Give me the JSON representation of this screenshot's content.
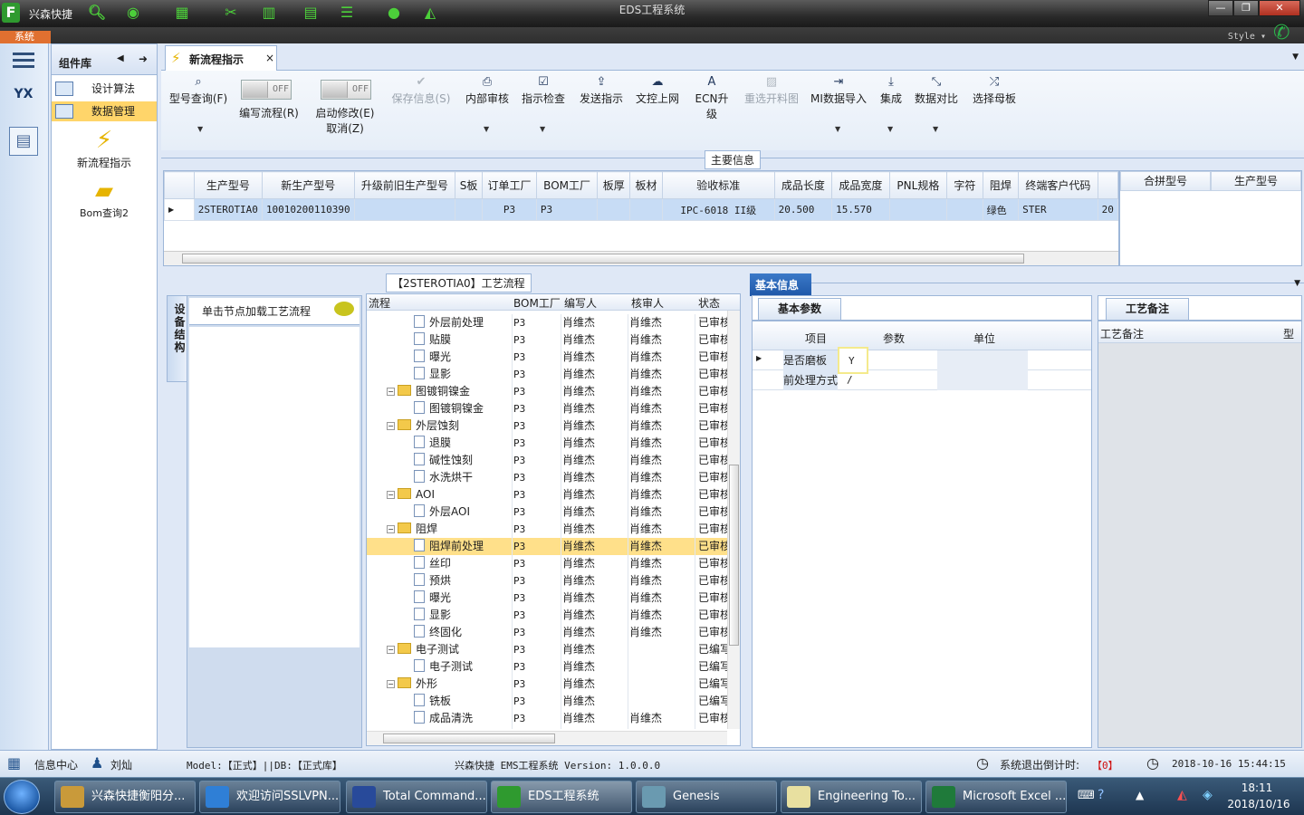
{
  "titlebar": {
    "app_name": "兴森快捷",
    "window_title": "EDS工程系统",
    "min": "—",
    "max": "❐",
    "close": "✕"
  },
  "menubar": {
    "system": "系统",
    "style": "Style"
  },
  "components": {
    "title": "组件库",
    "items": [
      {
        "label": "设计算法",
        "selected": false
      },
      {
        "label": "数据管理",
        "selected": true
      }
    ],
    "big_items": [
      "新流程指示",
      "Bom查询2"
    ]
  },
  "tab": {
    "label": "新流程指示",
    "close": "×"
  },
  "toolbar": {
    "type_query": "型号查询(F)",
    "edit_flow": "编写流程(R)",
    "enable_modify": "启动修改(E)",
    "cancel": "取消(Z)",
    "toggle_off": "OFF",
    "save_info": "保存信息(S)",
    "internal_review": "内部审核",
    "check_instruction": "指示检查",
    "send_instruction": "发送指示",
    "upload": "文控上网",
    "ecn_upgrade": "ECN升级",
    "reselect_drawing": "重选开料图",
    "mi_import": "MI数据导入",
    "integrate": "集成",
    "data_compare": "数据对比",
    "select_master": "选择母板"
  },
  "main_info": {
    "title": "主要信息",
    "columns": [
      "生产型号",
      "新生产型号",
      "升级前旧生产型号",
      "S板",
      "订单工厂",
      "BOM工厂",
      "板厚",
      "板材",
      "验收标准",
      "成品长度",
      "成品宽度",
      "PNL规格",
      "字符",
      "阻焊",
      "终端客户代码"
    ],
    "row": [
      "2STEROTIA0",
      "10010200110390",
      "",
      "",
      "P3",
      "P3",
      "",
      "",
      "IPC-6018 II级",
      "20.500",
      "15.570",
      "",
      "",
      "绿色",
      "STER"
    ],
    "row_tail": "20",
    "side_columns": [
      "合拼型号",
      "生产型号"
    ]
  },
  "flow": {
    "title": "【2STEROTIA0】工艺流程",
    "side_tab": "设备结构",
    "hint": "单击节点加载工艺流程",
    "columns": [
      "流程",
      "BOM工厂",
      "编写人",
      "核审人",
      "状态"
    ],
    "rows": [
      {
        "level": 2,
        "type": "doc",
        "name": "外层前处理",
        "factory": "P3",
        "writer": "肖维杰",
        "reviewer": "肖维杰",
        "status": "已审核"
      },
      {
        "level": 2,
        "type": "doc",
        "name": "贴膜",
        "factory": "P3",
        "writer": "肖维杰",
        "reviewer": "肖维杰",
        "status": "已审核"
      },
      {
        "level": 2,
        "type": "doc",
        "name": "曝光",
        "factory": "P3",
        "writer": "肖维杰",
        "reviewer": "肖维杰",
        "status": "已审核"
      },
      {
        "level": 2,
        "type": "doc",
        "name": "显影",
        "factory": "P3",
        "writer": "肖维杰",
        "reviewer": "肖维杰",
        "status": "已审核"
      },
      {
        "level": 1,
        "type": "folder",
        "name": "图镀铜镍金",
        "factory": "P3",
        "writer": "肖维杰",
        "reviewer": "肖维杰",
        "status": "已审核"
      },
      {
        "level": 2,
        "type": "doc",
        "name": "图镀铜镍金",
        "factory": "P3",
        "writer": "肖维杰",
        "reviewer": "肖维杰",
        "status": "已审核"
      },
      {
        "level": 1,
        "type": "folder",
        "name": "外层蚀刻",
        "factory": "P3",
        "writer": "肖维杰",
        "reviewer": "肖维杰",
        "status": "已审核"
      },
      {
        "level": 2,
        "type": "doc",
        "name": "退膜",
        "factory": "P3",
        "writer": "肖维杰",
        "reviewer": "肖维杰",
        "status": "已审核"
      },
      {
        "level": 2,
        "type": "doc",
        "name": "碱性蚀刻",
        "factory": "P3",
        "writer": "肖维杰",
        "reviewer": "肖维杰",
        "status": "已审核"
      },
      {
        "level": 2,
        "type": "doc",
        "name": "水洗烘干",
        "factory": "P3",
        "writer": "肖维杰",
        "reviewer": "肖维杰",
        "status": "已审核"
      },
      {
        "level": 1,
        "type": "folder",
        "name": "AOI",
        "factory": "P3",
        "writer": "肖维杰",
        "reviewer": "肖维杰",
        "status": "已审核"
      },
      {
        "level": 2,
        "type": "doc",
        "name": "外层AOI",
        "factory": "P3",
        "writer": "肖维杰",
        "reviewer": "肖维杰",
        "status": "已审核"
      },
      {
        "level": 1,
        "type": "folder",
        "name": "阻焊",
        "factory": "P3",
        "writer": "肖维杰",
        "reviewer": "肖维杰",
        "status": "已审核"
      },
      {
        "level": 2,
        "type": "doc",
        "name": "阻焊前处理",
        "factory": "P3",
        "writer": "肖维杰",
        "reviewer": "肖维杰",
        "status": "已审核",
        "selected": true
      },
      {
        "level": 2,
        "type": "doc",
        "name": "丝印",
        "factory": "P3",
        "writer": "肖维杰",
        "reviewer": "肖维杰",
        "status": "已审核"
      },
      {
        "level": 2,
        "type": "doc",
        "name": "预烘",
        "factory": "P3",
        "writer": "肖维杰",
        "reviewer": "肖维杰",
        "status": "已审核"
      },
      {
        "level": 2,
        "type": "doc",
        "name": "曝光",
        "factory": "P3",
        "writer": "肖维杰",
        "reviewer": "肖维杰",
        "status": "已审核"
      },
      {
        "level": 2,
        "type": "doc",
        "name": "显影",
        "factory": "P3",
        "writer": "肖维杰",
        "reviewer": "肖维杰",
        "status": "已审核"
      },
      {
        "level": 2,
        "type": "doc",
        "name": "终固化",
        "factory": "P3",
        "writer": "肖维杰",
        "reviewer": "肖维杰",
        "status": "已审核"
      },
      {
        "level": 1,
        "type": "folder",
        "name": "电子测试",
        "factory": "P3",
        "writer": "肖维杰",
        "reviewer": "",
        "status": "已编写"
      },
      {
        "level": 2,
        "type": "doc",
        "name": "电子测试",
        "factory": "P3",
        "writer": "肖维杰",
        "reviewer": "",
        "status": "已编写"
      },
      {
        "level": 1,
        "type": "folder",
        "name": "外形",
        "factory": "P3",
        "writer": "肖维杰",
        "reviewer": "",
        "status": "已编写"
      },
      {
        "level": 2,
        "type": "doc",
        "name": "铣板",
        "factory": "P3",
        "writer": "肖维杰",
        "reviewer": "",
        "status": "已编写"
      },
      {
        "level": 2,
        "type": "doc",
        "name": "成品清洗",
        "factory": "P3",
        "writer": "肖维杰",
        "reviewer": "肖维杰",
        "status": "已审核"
      }
    ]
  },
  "basic": {
    "tab": "基本信息",
    "subtab": "基本参数",
    "remark_tab": "工艺备注",
    "remark_col": "工艺备注",
    "remark_col2": "型",
    "columns": [
      "项目",
      "参数",
      "单位"
    ],
    "rows": [
      {
        "item": "是否磨板",
        "param": "Y",
        "unit": ""
      },
      {
        "item": "前处理方式",
        "param": "/",
        "unit": ""
      }
    ]
  },
  "status": {
    "info_center": "信息中心",
    "user": "刘灿",
    "model": "Model:【正式】||DB:【正式库】",
    "system": "兴森快捷 EMS工程系统 Version: 1.0.0.0",
    "countdown_label": "系统退出倒计时:",
    "countdown_value": "【0】",
    "datetime": "2018-10-16 15:44:15"
  },
  "taskbar": {
    "items": [
      "兴森快捷衡阳分...",
      "欢迎访问SSLVPN...",
      "Total Command...",
      "EDS工程系统",
      "Genesis",
      "Engineering To...",
      "Microsoft Excel ..."
    ],
    "time": "18:11",
    "date": "2018/10/16"
  }
}
